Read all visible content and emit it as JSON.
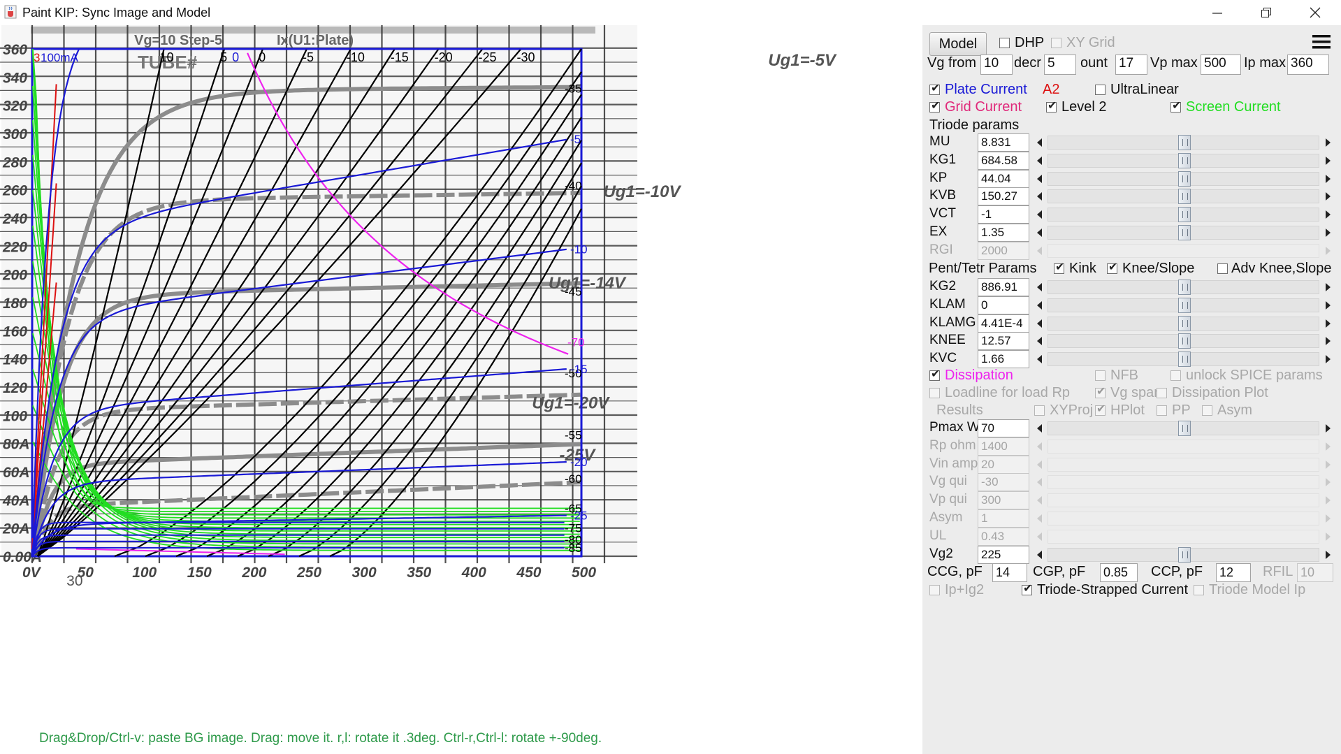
{
  "window": {
    "title": "Paint KIP: Sync Image and Model",
    "icon": "java-cup-icon",
    "controls": [
      "minimize-icon",
      "restore-icon",
      "close-icon"
    ]
  },
  "plot": {
    "bg_image": {
      "header_left": "Vg=10 Step-5",
      "header_mid": "Ix(U1:Plate)",
      "tube_label": "TUBE#",
      "curve_labels": [
        {
          "text": "Ug1=-5V",
          "x": 670,
          "y": 348
        },
        {
          "text": "Ug1=-10V",
          "x": 520,
          "y": 255
        },
        {
          "text": "Ug1=-14V",
          "x": 470,
          "y": 190
        },
        {
          "text": "Ug1=-20V",
          "x": 455,
          "y": 105
        },
        {
          "text": "-25V",
          "x": 480,
          "y": 68
        }
      ],
      "y_ticks": [
        {
          "label": "360",
          "value": 360
        },
        {
          "label": "340",
          "value": 340
        },
        {
          "label": "320",
          "value": 320
        },
        {
          "label": "300",
          "value": 300
        },
        {
          "label": "280",
          "value": 280
        },
        {
          "label": "260",
          "value": 260
        },
        {
          "label": "240",
          "value": 240
        },
        {
          "label": "220",
          "value": 220
        },
        {
          "label": "200",
          "value": 200
        },
        {
          "label": "180",
          "value": 180
        },
        {
          "label": "160",
          "value": 160
        },
        {
          "label": "140",
          "value": 140
        },
        {
          "label": "120",
          "value": 120
        },
        {
          "label": "100",
          "value": 100
        },
        {
          "label": "80A",
          "value": 80
        },
        {
          "label": "60A",
          "value": 60
        },
        {
          "label": "40A",
          "value": 40
        },
        {
          "label": "20A",
          "value": 20
        },
        {
          "label": "0.00A",
          "value": 0
        }
      ],
      "x_ticks": [
        {
          "label": "0V",
          "value": 0
        },
        {
          "label": "50",
          "value": 50
        },
        {
          "label": "100",
          "value": 100
        },
        {
          "label": "150",
          "value": 150
        },
        {
          "label": "200",
          "value": 200
        },
        {
          "label": "250",
          "value": 250
        },
        {
          "label": "300",
          "value": 300
        },
        {
          "label": "350",
          "value": 350
        },
        {
          "label": "400",
          "value": 400
        },
        {
          "label": "450",
          "value": 450
        },
        {
          "label": "500",
          "value": 500
        }
      ],
      "extra_x": [
        {
          "label": "30",
          "value": 30
        }
      ],
      "top_labels": [
        {
          "text": "10",
          "value": 120
        },
        {
          "text": "5",
          "value": 175
        },
        {
          "text": "0",
          "value": 210
        },
        {
          "text": "-5",
          "value": 250
        },
        {
          "text": "-10",
          "value": 290
        },
        {
          "text": "-15",
          "value": 330
        },
        {
          "text": "-20",
          "value": 370
        },
        {
          "text": "-25",
          "value": 410
        },
        {
          "text": "-30",
          "value": 445
        }
      ]
    },
    "model_labels": {
      "corner_red": "3",
      "corner_blue": "100mA",
      "top_blue": "0",
      "right_black": [
        {
          "text": "-35",
          "y": 332
        },
        {
          "text": "-40",
          "y": 263
        },
        {
          "text": "-45",
          "y": 188
        },
        {
          "text": "-50",
          "y": 130
        },
        {
          "text": "-55",
          "y": 86
        },
        {
          "text": "-60",
          "y": 55
        },
        {
          "text": "-65",
          "y": 34
        },
        {
          "text": "-75",
          "y": 20
        },
        {
          "text": "-80",
          "y": 12
        },
        {
          "text": "-85",
          "y": 6
        }
      ],
      "right_blue": [
        {
          "text": "-5",
          "y": 296
        },
        {
          "text": "-10",
          "y": 218
        },
        {
          "text": "-15",
          "y": 133
        },
        {
          "text": "-20",
          "y": 67
        },
        {
          "text": "-25",
          "y": 29
        }
      ],
      "magenta": {
        "text": "-70",
        "y": 152
      }
    },
    "axes": {
      "x_min": 0,
      "x_max": 500,
      "y_min": 0,
      "y_max": 360
    },
    "status_hint": "Drag&Drop/Ctrl-v: paste BG image. Drag: move it. r,l: rotate it .3deg. Ctrl-r,Ctrl-l: rotate +-90deg."
  },
  "panel": {
    "model_button": "Model",
    "dhp_label": "DHP",
    "xygrid_label": "XY Grid",
    "menu_icon": "hamburger-icon",
    "vg_from_label": "Vg from",
    "vg_from_value": "10",
    "decr_label": "decr",
    "decr_value": "5",
    "count_label": "ount",
    "count_value": "17",
    "vpmax_label": "Vp max",
    "vpmax_value": "500",
    "ipmax_label": "Ip max",
    "ipmax_value": "360",
    "plate_current_label": "Plate Current",
    "a2_label": "A2",
    "ultralinear_label": "UltraLinear",
    "grid_current_label": "Grid Current",
    "level2_label": "Level 2",
    "screen_current_label": "Screen Current",
    "triode_params_label": "Triode params",
    "triode_params": [
      {
        "name": "MU",
        "value": "8.831",
        "enabled": true
      },
      {
        "name": "KG1",
        "value": "684.58",
        "enabled": true
      },
      {
        "name": "KP",
        "value": "44.04",
        "enabled": true
      },
      {
        "name": "KVB",
        "value": "150.27",
        "enabled": true
      },
      {
        "name": "VCT",
        "value": "-1",
        "enabled": true
      },
      {
        "name": "EX",
        "value": "1.35",
        "enabled": true
      },
      {
        "name": "RGI",
        "value": "2000",
        "enabled": false
      }
    ],
    "pent_label": "Pent/Tetr Params",
    "kink_label": "Kink",
    "knee_slope_label": "Knee/Slope",
    "adv_knee_label": "Adv Knee,Slope",
    "pent_params": [
      {
        "name": "KG2",
        "value": "886.91",
        "enabled": true
      },
      {
        "name": "KLAM",
        "value": "0",
        "enabled": true
      },
      {
        "name": "KLAMG",
        "value": "4.41E-4",
        "enabled": true
      },
      {
        "name": "KNEE",
        "value": "12.57",
        "enabled": true
      },
      {
        "name": "KVC",
        "value": "1.66",
        "enabled": true
      }
    ],
    "dissipation_label": "Dissipation",
    "nfb_label": "NFB",
    "unlock_spice_label": "unlock SPICE params",
    "loadline_label": "Loadline for load Rp",
    "vg_span_label": "Vg span",
    "dissipation_plot_label": "Dissipation Plot",
    "results_label": "Results",
    "xyproj_label": "XYProj",
    "hplot_label": "HPlot",
    "pp_label": "PP",
    "asym_cb_label": "Asym",
    "load_params": [
      {
        "name": "Pmax W",
        "value": "70",
        "enabled": true
      },
      {
        "name": "Rp ohm",
        "value": "1400",
        "enabled": false
      },
      {
        "name": "Vin ampl",
        "value": "20",
        "enabled": false
      },
      {
        "name": "Vg qui",
        "value": "-30",
        "enabled": false
      },
      {
        "name": "Vp qui",
        "value": "300",
        "enabled": false
      },
      {
        "name": "Asym",
        "value": "1",
        "enabled": false
      },
      {
        "name": "UL",
        "value": "0.43",
        "enabled": false
      },
      {
        "name": "Vg2",
        "value": "225",
        "enabled": true
      }
    ],
    "ccg_label": "CCG, pF",
    "ccg_value": "14",
    "cgp_label": "CGP, pF",
    "cgp_value": "0.85",
    "ccp_label": "CCP, pF",
    "ccp_value": "12",
    "rfil_label": "RFIL",
    "rfil_value": "10",
    "ipig2_label": "Ip+Ig2",
    "triode_strapped_label": "Triode-Strapped Current",
    "triode_model_label": "Triode Model Ip"
  },
  "colors": {
    "plate": "#1a1ad6",
    "grid": "#dd1111",
    "screen": "#22dd22",
    "dissipation": "#ee22ee",
    "a2": "#dd1111"
  }
}
